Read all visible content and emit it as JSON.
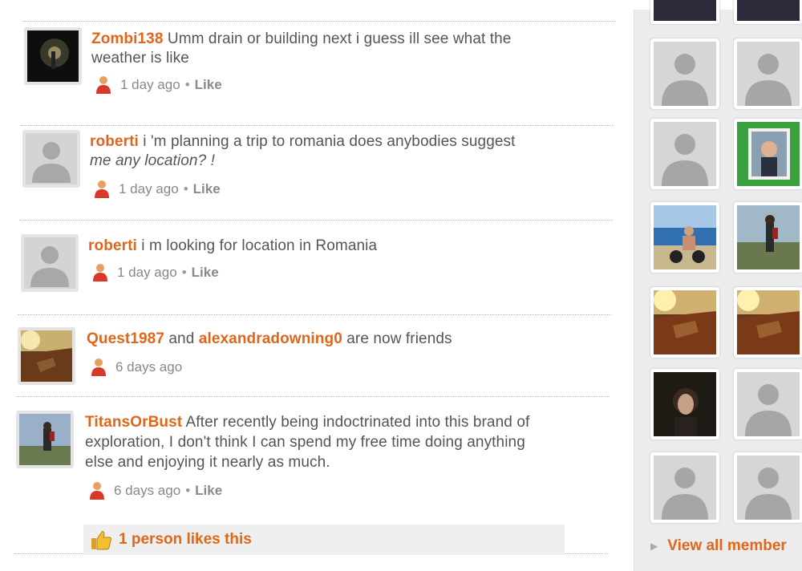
{
  "feed": {
    "entries": [
      {
        "avatar": "photo-dark-tunnel",
        "user": "Zombi138",
        "line1": " Umm drain or building next i guess ill see what the",
        "line2": "weather is like",
        "time": "1 day ago",
        "like": "Like"
      },
      {
        "avatar": "default-silhouette",
        "user": "roberti",
        "line1": " i 'm planning a trip to romania does anybodies suggest",
        "line2": "me any location? !",
        "time": "1 day ago",
        "like": "Like"
      },
      {
        "avatar": "default-silhouette",
        "user": "roberti",
        "line1": " i m looking for location in Romania",
        "time": "1 day ago",
        "like": "Like"
      },
      {
        "avatar": "photo-rust-sunset",
        "user": "Quest1987",
        "and_text": " and ",
        "user2": "alexandradowning0",
        "suffix": " are now friends",
        "time": "6 days ago"
      },
      {
        "avatar": "photo-person-hill",
        "user": "TitansOrBust",
        "line1": " After recently being indoctrinated into this brand of",
        "line2": "exploration, I don't think I can spend my free time doing anything",
        "line3": "else and enjoying it nearly as much.",
        "time": "6 days ago",
        "like": "Like",
        "likes_summary": "1 person likes this"
      }
    ]
  },
  "sidebar": {
    "members": [
      "default-silhouette",
      "default-silhouette",
      "default-silhouette",
      "photo-man-green-frame",
      "photo-beach-rider",
      "photo-person-hill",
      "photo-rust-sunset",
      "photo-rust-sunset",
      "photo-woman-dark",
      "default-silhouette",
      "default-silhouette",
      "default-silhouette"
    ],
    "view_all_label": "View all member"
  },
  "colors": {
    "username": "#e0661c",
    "text": "#555555",
    "meta": "#888888",
    "sidebar_bg": "#ececec"
  }
}
